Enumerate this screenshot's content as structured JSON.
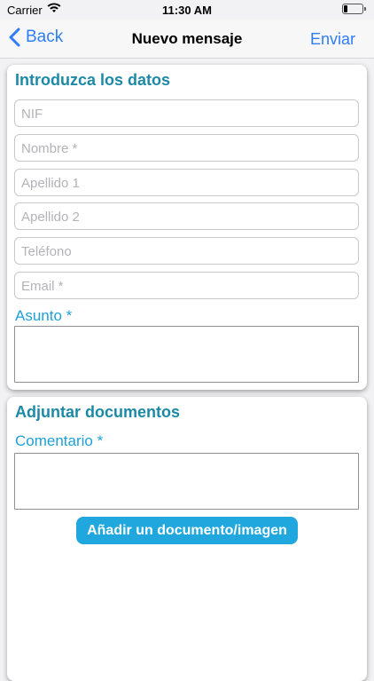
{
  "status_bar": {
    "carrier": "Carrier",
    "time": "11:30 AM",
    "battery_level": 0.2
  },
  "nav": {
    "back_label": "Back",
    "title": "Nuevo mensaje",
    "send_label": "Enviar"
  },
  "form": {
    "section_title": "Introduzca los datos",
    "fields": [
      {
        "placeholder": "NIF"
      },
      {
        "placeholder": "Nombre *"
      },
      {
        "placeholder": "Apellido 1"
      },
      {
        "placeholder": "Apellido 2"
      },
      {
        "placeholder": "Teléfono"
      },
      {
        "placeholder": "Email *"
      }
    ],
    "subject_label": "Asunto *"
  },
  "attachments": {
    "section_title": "Adjuntar documentos",
    "comment_label": "Comentario *",
    "add_button_label": "Añadir un documento/imagen"
  },
  "colors": {
    "accent": "#1c8aa6",
    "link": "#2f7df6",
    "button": "#20a8de"
  }
}
